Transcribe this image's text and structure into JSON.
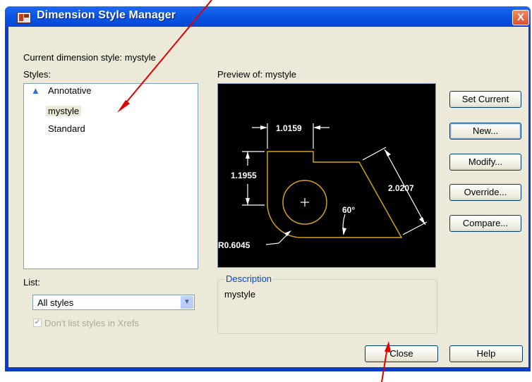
{
  "window": {
    "title": "Dimension Style Manager",
    "close_glyph": "X"
  },
  "current_style": {
    "label": "Current dimension style: mystyle"
  },
  "styles": {
    "label": "Styles:",
    "items": [
      {
        "label": "Annotative",
        "icon": "annotative-icon"
      },
      {
        "label": "mystyle"
      },
      {
        "label": "Standard"
      }
    ]
  },
  "preview": {
    "label": "Preview of: mystyle",
    "dims": {
      "top": "1.0159",
      "left": "1.1955",
      "right": "2.0207",
      "angle": "60°",
      "radius": "R0.6045"
    }
  },
  "buttons": {
    "set_current": "Set Current",
    "new": "New...",
    "modify": "Modify...",
    "override": "Override...",
    "compare": "Compare..."
  },
  "list": {
    "label": "List:",
    "value": "All styles",
    "arrow": "▼",
    "xref_checkbox": "Don't list styles in Xrefs"
  },
  "description": {
    "legend": "Description",
    "text": "mystyle"
  },
  "footer": {
    "close": "Close",
    "help": "Help"
  },
  "colors": {
    "titlebar": "#0a56e4",
    "dialog_bg": "#ece9d8",
    "preview_bg": "#000000",
    "preview_geometry": "#d4a017",
    "annotation_arrow": "#e00000"
  }
}
